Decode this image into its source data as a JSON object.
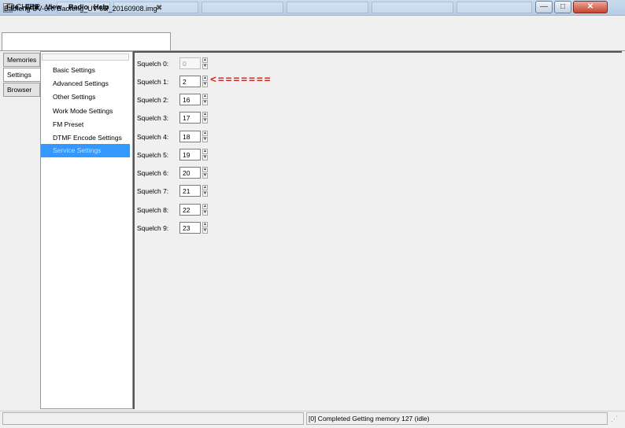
{
  "window": {
    "title": "CHIRP",
    "controls": {
      "minimize": "—",
      "maximize": "□",
      "close": "✕"
    }
  },
  "background_windows": [
    "",
    "",
    "",
    "",
    "",
    "",
    "",
    ""
  ],
  "menu": [
    "File",
    "Edit",
    "View",
    "Radio",
    "Help"
  ],
  "document_tab": {
    "label": "Baofeng UV-6R: Baofeng_UV-6R_20160908.img*",
    "close_icon": "✖"
  },
  "side_tabs": [
    "Memories",
    "Settings",
    "Browser"
  ],
  "tree": {
    "items": [
      "Basic Settings",
      "Advanced Settings",
      "Other Settings",
      "Work Mode Settings",
      "FM Preset",
      "DTMF Encode Settings"
    ],
    "selected": "Service Settings"
  },
  "squelch": [
    {
      "label": "Squelch 0:",
      "value": "0",
      "disabled": true
    },
    {
      "label": "Squelch 1:",
      "value": "2"
    },
    {
      "label": "Squelch 2:",
      "value": "16"
    },
    {
      "label": "Squelch 3:",
      "value": "17"
    },
    {
      "label": "Squelch 4:",
      "value": "18"
    },
    {
      "label": "Squelch 5:",
      "value": "19"
    },
    {
      "label": "Squelch 6:",
      "value": "20"
    },
    {
      "label": "Squelch 7:",
      "value": "21"
    },
    {
      "label": "Squelch 8:",
      "value": "22"
    },
    {
      "label": "Squelch 9:",
      "value": "23"
    }
  ],
  "annotation_arrow": "<=======",
  "status": {
    "text": "[0] Completed Getting memory 127 (idle)"
  },
  "colors": {
    "selection": "#3399ff",
    "annotation": "#e0241b"
  }
}
